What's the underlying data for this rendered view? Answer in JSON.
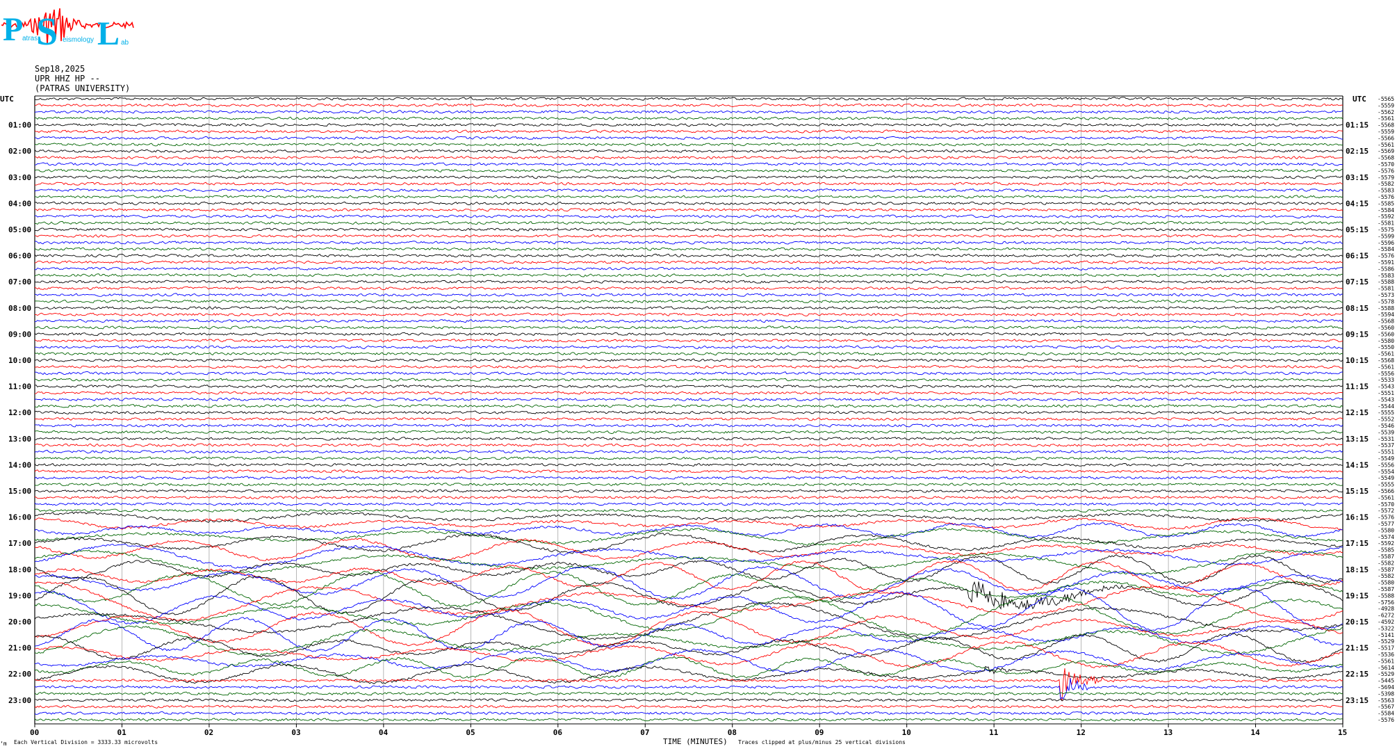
{
  "logo": {
    "big_letters": [
      "P",
      "S",
      "L"
    ],
    "small_text": [
      "atras",
      "eismology",
      "ab"
    ],
    "text_color": "#00b0e8",
    "wave_color": "#ff0000"
  },
  "header": {
    "date": "Sep18,2025",
    "station": "UPR HHZ HP --",
    "institution": "(PATRAS UNIVERSITY)"
  },
  "axis": {
    "left_unit": "UTC",
    "right_unit": "UTC",
    "x_title": "TIME (MINUTES)",
    "left_note": "Each Vertical Division = 3333.33 microvolts",
    "center_note": "Traces clipped at plus/minus 25 vertical divisions",
    "corner_mark": "‘m"
  },
  "colors": {
    "trace_cycle": [
      "#000000",
      "#ff0000",
      "#0000ff",
      "#006400"
    ],
    "grid": "#888888"
  },
  "chart_data": {
    "type": "line",
    "title": "",
    "xlabel": "TIME (MINUTES)",
    "xlim": [
      0,
      15
    ],
    "x_ticks": [
      "00",
      "01",
      "02",
      "03",
      "04",
      "05",
      "06",
      "07",
      "08",
      "09",
      "10",
      "11",
      "12",
      "13",
      "14",
      "15"
    ],
    "rows_count": 96,
    "minutes_per_row": 15,
    "left_hour_labels": [
      "01:00",
      "02:00",
      "03:00",
      "04:00",
      "05:00",
      "06:00",
      "07:00",
      "08:00",
      "09:00",
      "10:00",
      "11:00",
      "12:00",
      "13:00",
      "14:00",
      "15:00",
      "16:00",
      "17:00",
      "18:00",
      "19:00",
      "20:00",
      "21:00",
      "22:00",
      "23:00"
    ],
    "right_hour_labels": [
      "01:15",
      "02:15",
      "03:15",
      "04:15",
      "05:15",
      "06:15",
      "07:15",
      "08:15",
      "09:15",
      "10:15",
      "11:15",
      "12:15",
      "13:15",
      "14:15",
      "15:15",
      "16:15",
      "17:15",
      "18:15",
      "19:15",
      "20:15",
      "21:15",
      "22:15",
      "23:15"
    ],
    "row_offsets": [
      "-5565",
      "-5559",
      "-5562",
      "-5561",
      "-5568",
      "-5559",
      "-5566",
      "-5561",
      "-5569",
      "-5568",
      "-5570",
      "-5576",
      "-5579",
      "-5582",
      "-5583",
      "-5576",
      "-5585",
      "-5584",
      "-5592",
      "-5581",
      "-5575",
      "-5599",
      "-5596",
      "-5584",
      "-5576",
      "-5591",
      "-5586",
      "-5583",
      "-5588",
      "-5581",
      "-5573",
      "-5578",
      "-5588",
      "-5594",
      "-5568",
      "-5560",
      "-5560",
      "-5580",
      "-5550",
      "-5561",
      "-5568",
      "-5561",
      "-5556",
      "-5533",
      "-5543",
      "-5551",
      "-5543",
      "-5544",
      "-5555",
      "-5552",
      "-5546",
      "-5539",
      "-5531",
      "-5537",
      "-5551",
      "-5549",
      "-5556",
      "-5554",
      "-5549",
      "-5555",
      "-5566",
      "-5561",
      "-5570",
      "-5572",
      "-5576",
      "-5577",
      "-5580",
      "-5574",
      "-5592",
      "-5585",
      "-5587",
      "-5582",
      "-5587",
      "-5582",
      "-5580",
      "-5587",
      "-5588",
      "-5756",
      "-4928",
      "-6272",
      "-4592",
      "-5322",
      "-5141",
      "-5529",
      "-5517",
      "-5536",
      "-5561",
      "-5614",
      "-5529",
      "-5445",
      "-5694",
      "-5398",
      "-5563",
      "-5567",
      "-5584",
      "-5576"
    ],
    "events": [
      {
        "start_hour": "16:00",
        "end_hour": "22:15",
        "description_level": "teleseismic surface waves"
      },
      {
        "hour": "19:00",
        "minute": 11.0,
        "amplitude": "high"
      },
      {
        "hour": "22:00",
        "minute": 11.0,
        "amplitude": "medium"
      },
      {
        "hour": "22:00",
        "minute": 11.9,
        "amplitude": "high"
      }
    ]
  }
}
